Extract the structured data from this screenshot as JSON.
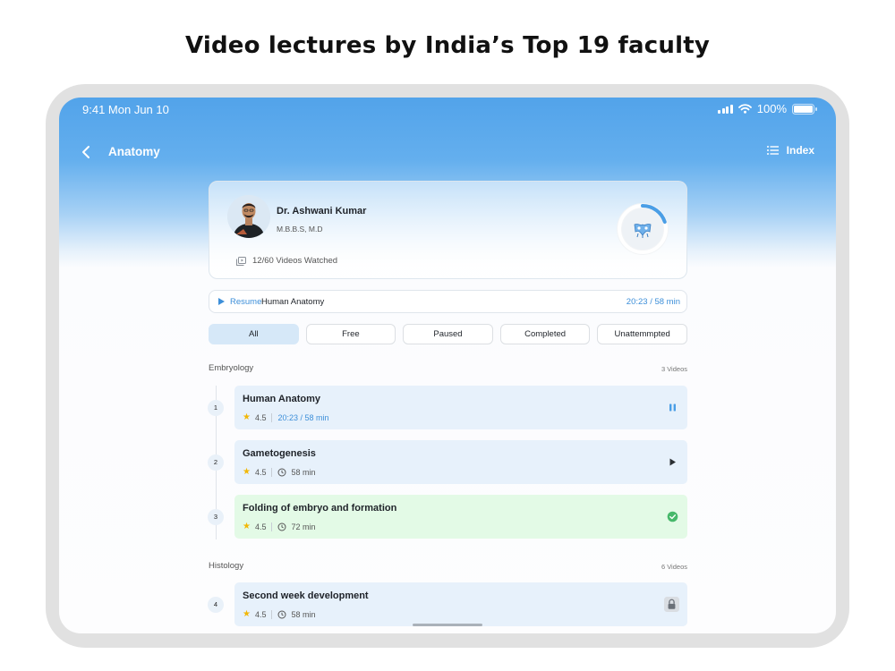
{
  "headline": "Video lectures by India’s Top 19 faculty",
  "status_bar": {
    "time": "9:41  Mon Jun 10",
    "battery": "100%"
  },
  "nav": {
    "title": "Anatomy",
    "index_label": "Index"
  },
  "faculty": {
    "name": "Dr. Ashwani Kumar",
    "degree": "M.B.B.S, M.D",
    "videos_watched": "12/60 Videos Watched",
    "progress_fraction": 0.2
  },
  "resume": {
    "label": "Resume",
    "topic": "Human Anatomy",
    "time": "20:23 / 58 min"
  },
  "filters": [
    "All",
    "Free",
    "Paused",
    "Completed",
    "Unattemmpted"
  ],
  "sections": [
    {
      "name": "Embryology",
      "count": "3 Videos"
    },
    {
      "name": "Histology",
      "count": "6 Videos"
    }
  ],
  "lessons": [
    {
      "num": "1",
      "title": "Human Anatomy",
      "rating": "4.5",
      "duration": "20:23 / 58 min",
      "state": "paused"
    },
    {
      "num": "2",
      "title": "Gametogenesis",
      "rating": "4.5",
      "duration": "58 min",
      "state": "play"
    },
    {
      "num": "3",
      "title": "Folding of embryo and formation",
      "rating": "4.5",
      "duration": "72 min",
      "state": "completed"
    },
    {
      "num": "4",
      "title": "Second week development",
      "rating": "4.5",
      "duration": "58 min",
      "state": "locked"
    }
  ],
  "colors": {
    "accent": "#3d8fd9",
    "header_blue": "#52a3ea",
    "completed_bg": "#e3fae6",
    "lesson_bg": "#e7f1fb",
    "star": "#f2b705"
  }
}
